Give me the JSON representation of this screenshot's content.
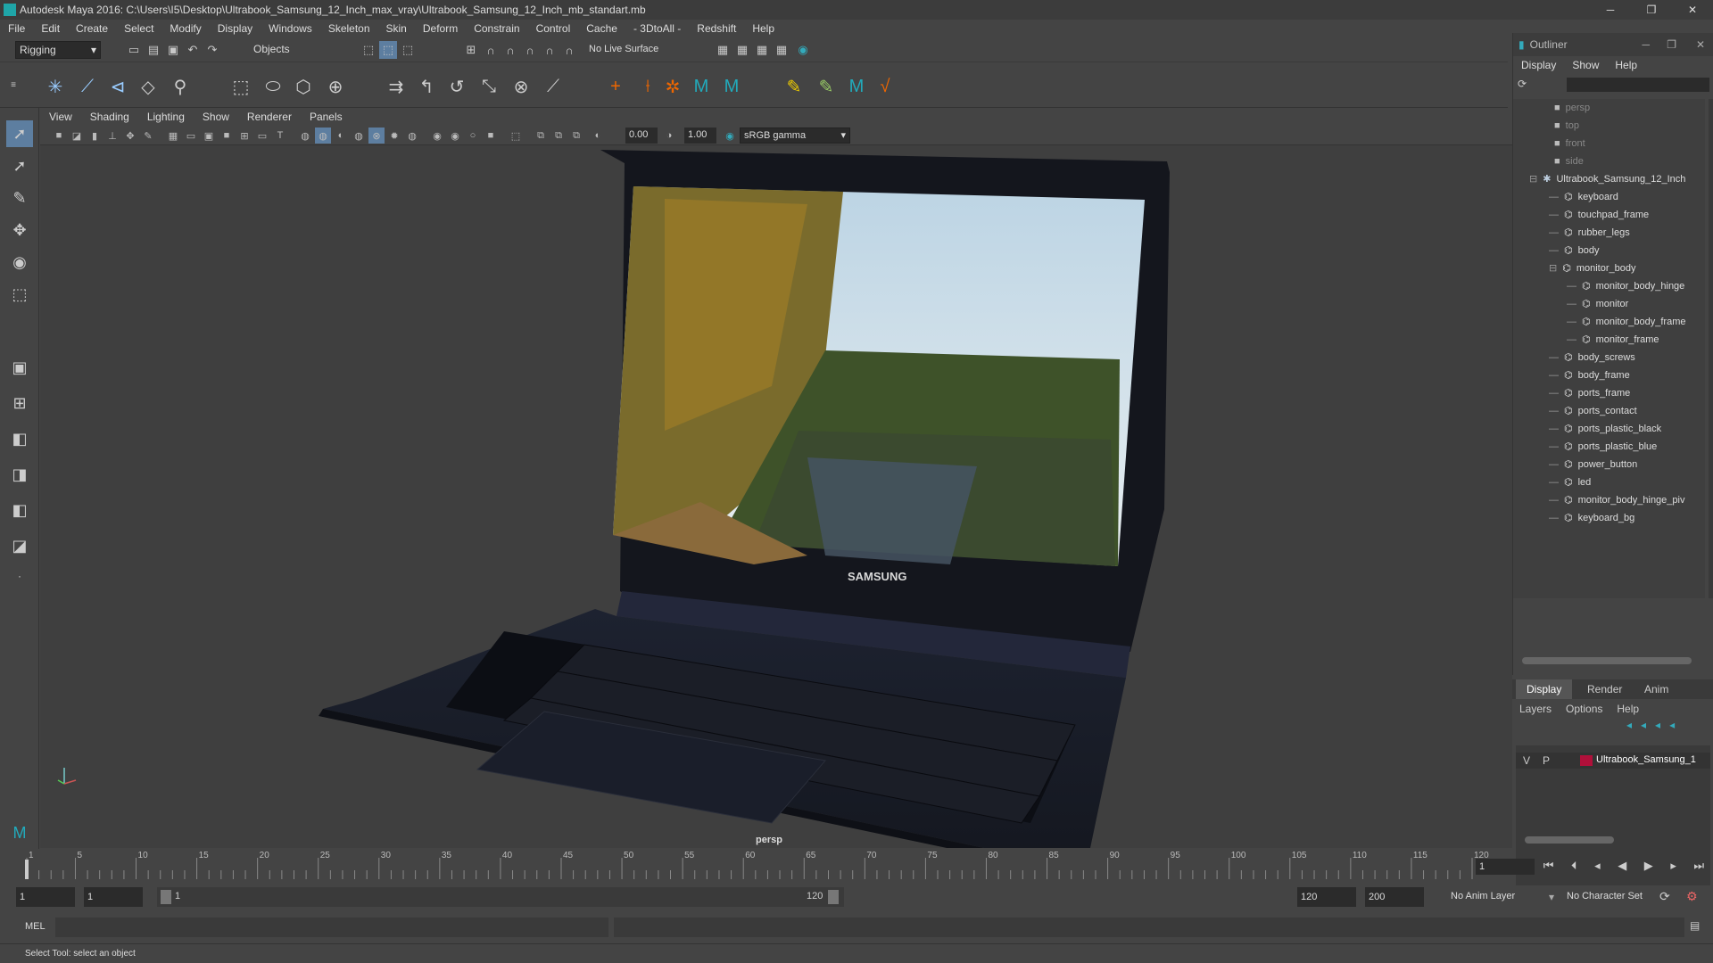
{
  "window": {
    "title": "Autodesk Maya 2016: C:\\Users\\I5\\Desktop\\Ultrabook_Samsung_12_Inch_max_vray\\Ultrabook_Samsung_12_Inch_mb_standart.mb",
    "minimize": "─",
    "maximize": "❐",
    "close": "✕"
  },
  "menu": [
    "File",
    "Edit",
    "Create",
    "Select",
    "Modify",
    "Display",
    "Windows",
    "Skeleton",
    "Skin",
    "Deform",
    "Constrain",
    "Control",
    "Cache",
    "- 3DtoAll -",
    "Redshift",
    "Help"
  ],
  "status": {
    "mode": "Rigging",
    "objects": "Objects",
    "live_surface": "No Live Surface"
  },
  "viewport": {
    "menu": [
      "View",
      "Shading",
      "Lighting",
      "Show",
      "Renderer",
      "Panels"
    ],
    "exposure": "0.00",
    "gamma": "1.00",
    "color_space": "sRGB gamma",
    "camera_label": "persp",
    "brand": "SAMSUNG"
  },
  "outliner": {
    "title": "Outliner",
    "menu": [
      "Display",
      "Show",
      "Help"
    ],
    "cameras": [
      "persp",
      "top",
      "front",
      "side"
    ],
    "root": "Ultrabook_Samsung_12_Inch",
    "children": [
      "keyboard",
      "touchpad_frame",
      "rubber_legs",
      "body",
      "monitor_body"
    ],
    "monitor_children": [
      "monitor_body_hinge",
      "monitor",
      "monitor_body_frame",
      "monitor_frame"
    ],
    "rest": [
      "body_screws",
      "body_frame",
      "ports_frame",
      "ports_contact",
      "ports_plastic_black",
      "ports_plastic_blue",
      "power_button",
      "led",
      "monitor_body_hinge_piv",
      "keyboard_bg"
    ]
  },
  "layers": {
    "tabs": [
      "Display",
      "Render",
      "Anim"
    ],
    "menu": [
      "Layers",
      "Options",
      "Help"
    ],
    "v": "V",
    "p": "P",
    "layer_name": "Ultrabook_Samsung_1",
    "layer_color": "#b0103a"
  },
  "timeline": {
    "ticks": [
      "1",
      "5",
      "10",
      "15",
      "20",
      "25",
      "30",
      "35",
      "40",
      "45",
      "50",
      "55",
      "60",
      "65",
      "70",
      "75",
      "80",
      "85",
      "90",
      "95",
      "100",
      "105",
      "110",
      "115",
      "120"
    ],
    "current_frame": "1"
  },
  "range": {
    "start": "1",
    "start2": "1",
    "range_start": "1",
    "range_end": "120",
    "end": "120",
    "end2": "200",
    "anim_layer": "No Anim Layer",
    "char_set": "No Character Set"
  },
  "cmd": {
    "label": "MEL"
  },
  "help": {
    "text": "Select Tool: select an object"
  }
}
